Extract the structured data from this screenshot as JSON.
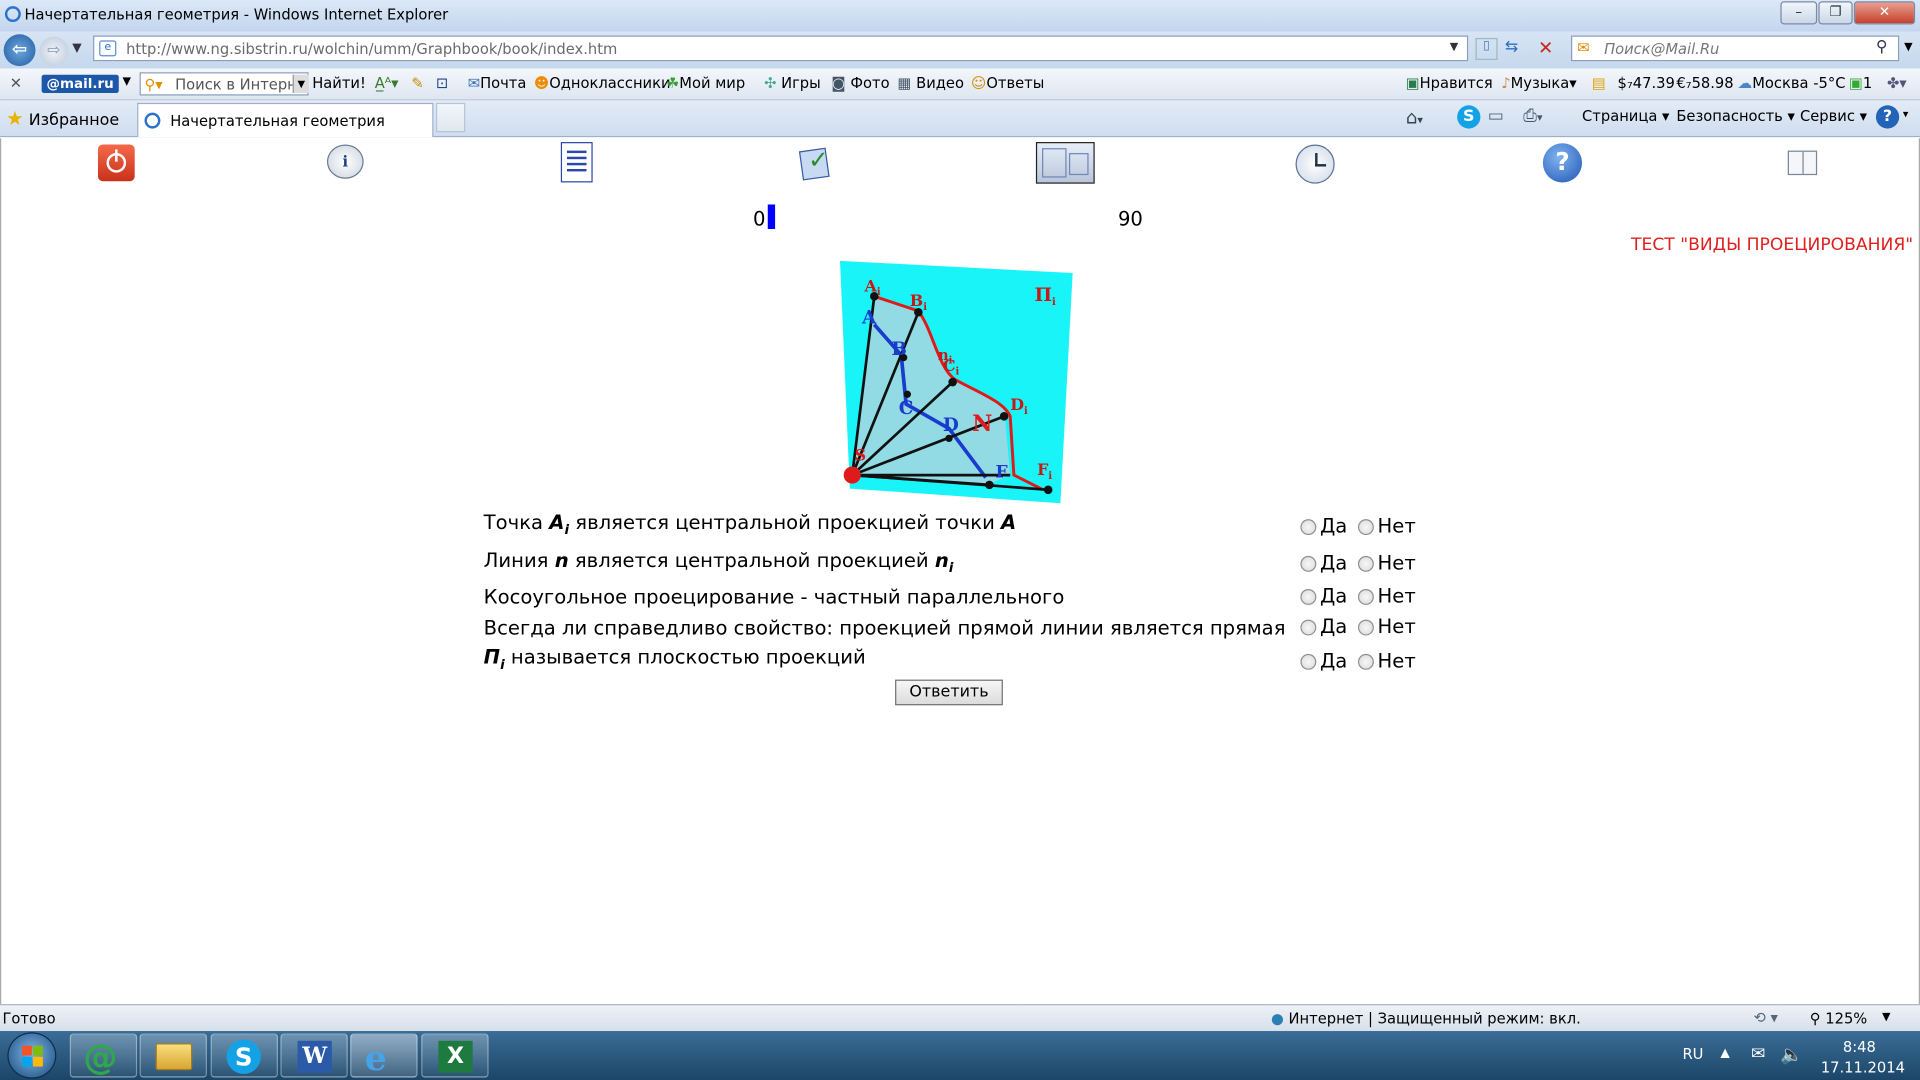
{
  "window": {
    "title": "Начертательная геометрия - Windows Internet Explorer",
    "address": "http://www.ng.sibstrin.ru/wolchin/umm/Graphbook/book/index.htm",
    "search_placeholder": "Поиск@Mail.Ru"
  },
  "toolbar2": {
    "mail_logo": "@mail.ru",
    "search_placeholder": "Поиск в Интернете",
    "find": "Найти!",
    "pochta": "Почта",
    "odnoklassniki": "Одноклассники",
    "moy_mir": "Мой мир",
    "igry": "Игры",
    "foto": "Фото",
    "video": "Видео",
    "otvety": "Ответы",
    "nravitsya": "Нравится",
    "muzyka": "Музыка",
    "usd": "$₇47.39",
    "eur": "€₇58.98",
    "weather": "Москва -5°C",
    "mail_count": "1"
  },
  "tabs": {
    "favorites": "Избранное",
    "tab_title": "Начертательная геометрия",
    "page": "Страница",
    "security": "Безопасность",
    "service": "Сервис"
  },
  "page": {
    "progress_start": "0",
    "progress_end": "90",
    "progress_fraction": 0.02,
    "test_title": "ТЕСТ \"ВИДЫ ПРОЕЦИРОВАНИЯ\"",
    "figure_labels": {
      "A1": "A",
      "B1": "B",
      "C1": "C",
      "D1": "D",
      "F1": "F",
      "n1": "n",
      "P1": "П",
      "sub": "i",
      "A": "A",
      "B": "B",
      "C": "C",
      "D": "D",
      "F": "F",
      "N": "N",
      "S": "S"
    },
    "questions": [
      {
        "pre": "Точка ",
        "b1": "A",
        "sub": "i",
        "post": " является центральной проекцией точки ",
        "b2": "A"
      },
      {
        "pre": "Линия ",
        "b1": "n",
        "post": " является центральной проекцией ",
        "b2": "n",
        "sub2": "i"
      },
      {
        "pre": "Косоугольное проецирование - частный параллельного"
      },
      {
        "pre": "Всегда ли справедливо свойство: проекцией прямой линии является прямая"
      },
      {
        "b1": "П",
        "sub": "i",
        "post": " называется плоскостью проекций"
      }
    ],
    "yes": "Да",
    "no": "Нет",
    "submit": "Ответить"
  },
  "status": {
    "ready": "Готово",
    "zone": "Интернет | Защищенный режим: вкл.",
    "zoom": "125%"
  },
  "taskbar": {
    "lang": "RU",
    "time": "8:48",
    "date": "17.11.2014"
  }
}
